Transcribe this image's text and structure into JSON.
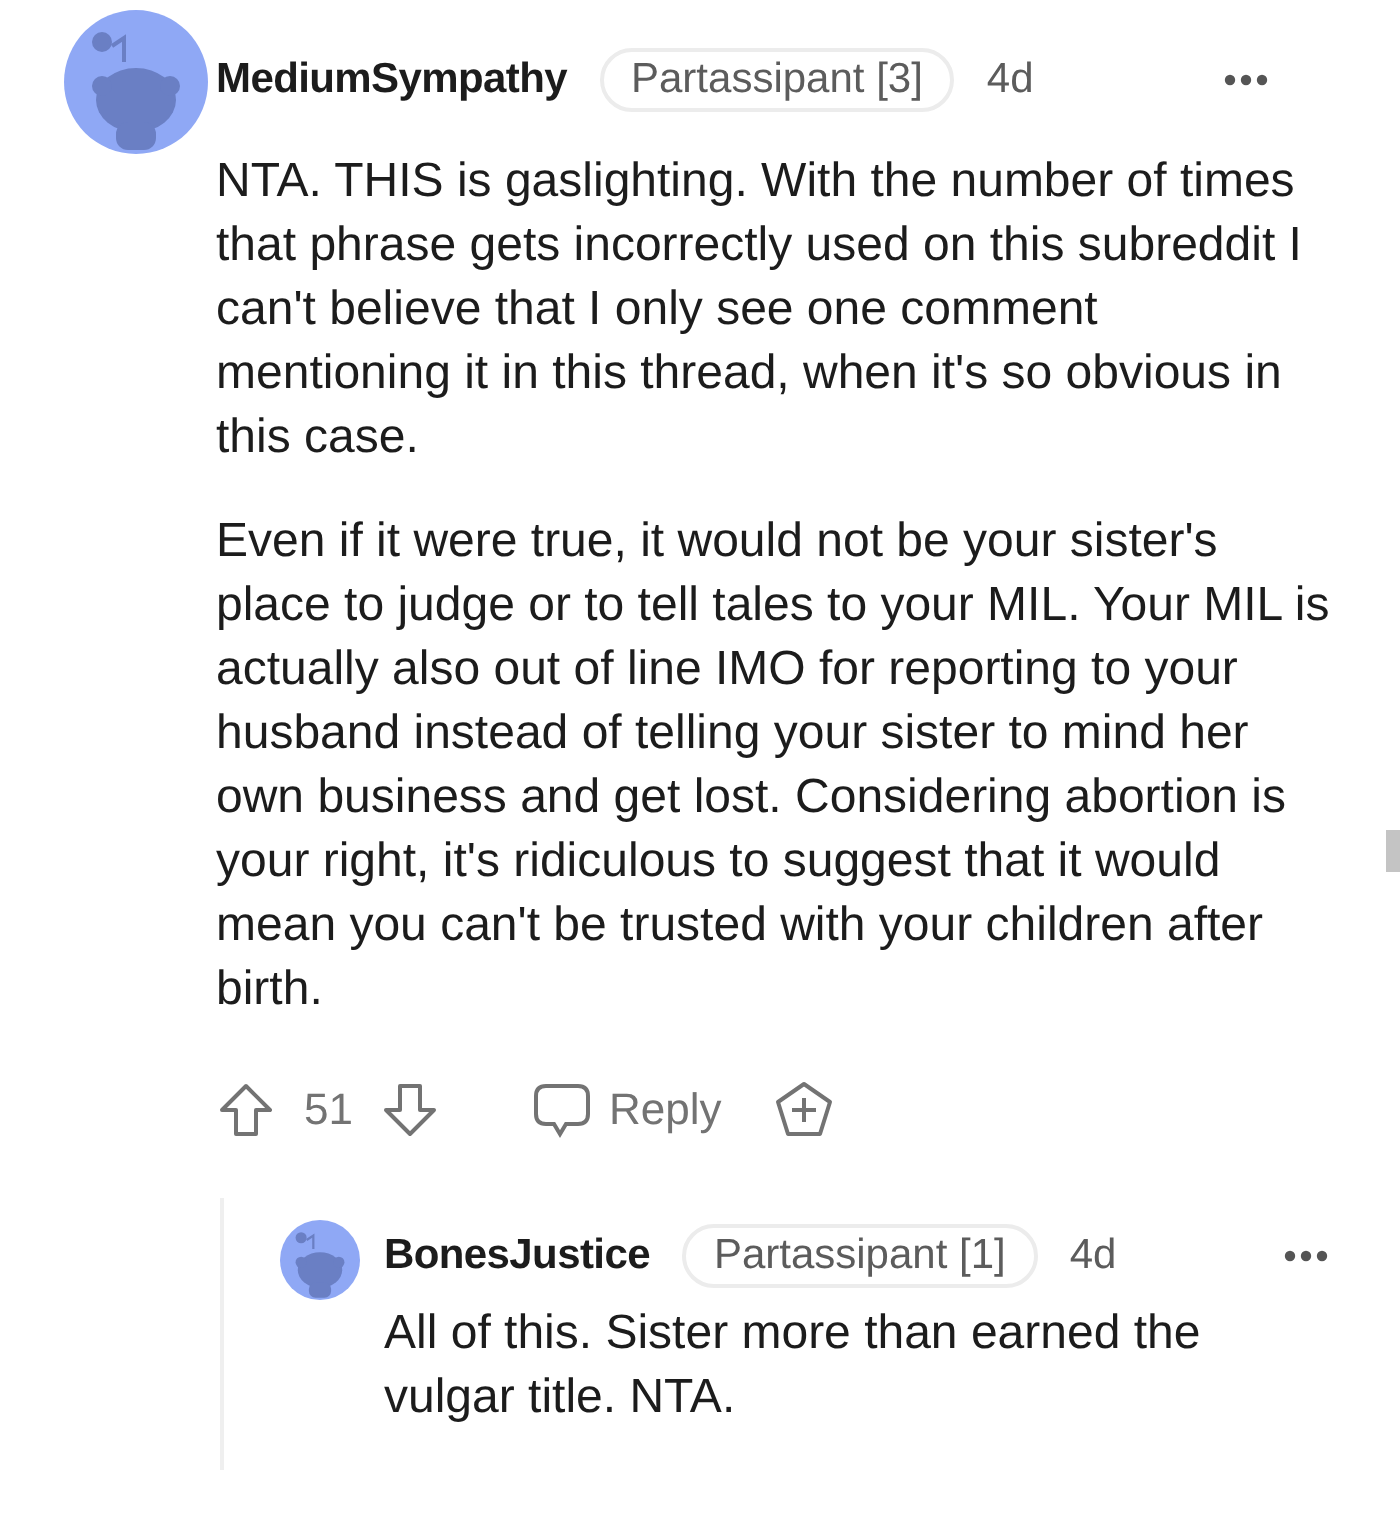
{
  "comments": [
    {
      "author": "MediumSympathy",
      "flair": "Partassipant [3]",
      "age": "4d",
      "paragraphs": [
        "NTA. THIS is gaslighting. With the number of times that phrase gets incorrectly used on this subreddit I can't believe that I only see one comment mentioning it in this thread, when it's so obvious in this case.",
        "Even if it were true, it would not be your sister's place to judge or to tell tales to your MIL. Your MIL is actually also out of line IMO for reporting to your husband instead of telling your sister to mind her own business and get lost. Considering abortion is your right, it's ridiculous to suggest that it would mean you can't be trusted with your children after birth."
      ],
      "score": "51",
      "reply_label": "Reply",
      "replies": [
        {
          "author": "BonesJustice",
          "flair": "Partassipant [1]",
          "age": "4d",
          "paragraphs": [
            "All of this. Sister more than earned the vulgar title. NTA."
          ]
        }
      ]
    }
  ]
}
